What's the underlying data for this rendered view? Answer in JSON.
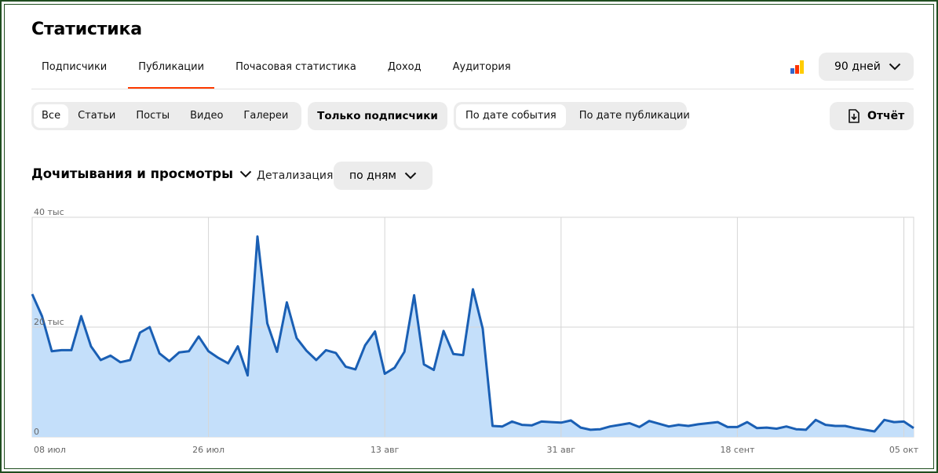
{
  "page": {
    "title": "Статистика"
  },
  "tabs": [
    {
      "label": "Подписчики",
      "active": false
    },
    {
      "label": "Публикации",
      "active": true
    },
    {
      "label": "Почасовая статистика",
      "active": false
    },
    {
      "label": "Доход",
      "active": false
    },
    {
      "label": "Аудитория",
      "active": false
    }
  ],
  "period": {
    "label": "90 дней",
    "icon": "chevron-down-icon"
  },
  "app_logo": {
    "colors": [
      "#3366cc",
      "#ff3300",
      "#ffcc00"
    ]
  },
  "filters": {
    "content_types": [
      {
        "label": "Все",
        "selected": true
      },
      {
        "label": "Статьи",
        "selected": false
      },
      {
        "label": "Посты",
        "selected": false
      },
      {
        "label": "Видео",
        "selected": false
      },
      {
        "label": "Галереи",
        "selected": false
      }
    ],
    "only_subscribers": "Только подписчики",
    "date_mode": [
      {
        "label": "По дате события",
        "selected": true
      },
      {
        "label": "По дате публикации",
        "selected": false
      }
    ]
  },
  "report": {
    "label": "Отчёт",
    "icon": "report-export-icon"
  },
  "metric": {
    "label": "Дочитывания и просмотры",
    "icon": "chevron-down-icon"
  },
  "detail": {
    "label": "Детализация",
    "value": "по дням"
  },
  "colors": {
    "line": "#1a5fb4",
    "area": "#c4dffa",
    "grid": "#d6d6d6",
    "accent": "#ff3b00",
    "button_bg": "#ececec"
  },
  "chart_data": {
    "type": "area",
    "title": "",
    "xlabel": "",
    "ylabel": "",
    "ylim": [
      0,
      40000
    ],
    "y_ticks": [
      {
        "value": 0,
        "label": "0"
      },
      {
        "value": 20000,
        "label": "20 тыс"
      },
      {
        "value": 40000,
        "label": "40 тыс"
      }
    ],
    "x_ticks": [
      {
        "index": 0,
        "label": "08 июл"
      },
      {
        "index": 18,
        "label": "26 июл"
      },
      {
        "index": 36,
        "label": "13 авг"
      },
      {
        "index": 54,
        "label": "31 авг"
      },
      {
        "index": 72,
        "label": "18 сент"
      },
      {
        "index": 89,
        "label": "05 окт"
      }
    ],
    "grid": true,
    "series": [
      {
        "values": [
          26000,
          22000,
          15600,
          15800,
          15800,
          22000,
          16500,
          14000,
          14800,
          13600,
          14000,
          19000,
          20000,
          15200,
          13800,
          15400,
          15600,
          18300,
          15600,
          14400,
          13400,
          16500,
          11200,
          36500,
          20700,
          15500,
          24500,
          18000,
          15700,
          14000,
          15800,
          15300,
          12800,
          12300,
          16700,
          19200,
          11500,
          12600,
          15500,
          25800,
          13200,
          12200,
          19300,
          15100,
          14900,
          26900,
          19700,
          2000,
          1900,
          2800,
          2200,
          2100,
          2800,
          2700,
          2600,
          3000,
          1700,
          1300,
          1400,
          1900,
          2200,
          2500,
          1800,
          2900,
          2400,
          1900,
          2200,
          2000,
          2300,
          2500,
          2700,
          1800,
          1800,
          2700,
          1600,
          1700,
          1500,
          1900,
          1400,
          1300,
          3100,
          2200,
          2000,
          2000,
          1600,
          1300,
          1000,
          3100,
          2700,
          2800,
          1600
        ]
      }
    ]
  }
}
